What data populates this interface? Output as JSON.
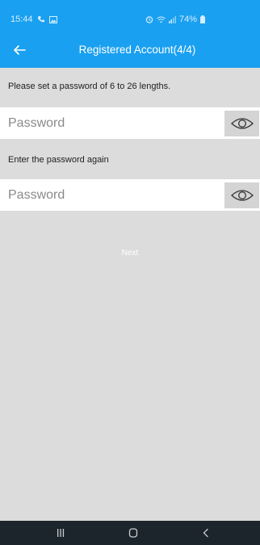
{
  "status_bar": {
    "time": "15:44",
    "battery": "74%"
  },
  "app_bar": {
    "title": "Registered Account(4/4)"
  },
  "form": {
    "password_hint": "Please set a password of 6 to 26 lengths.",
    "password_placeholder": "Password",
    "confirm_hint": "Enter the password again",
    "confirm_placeholder": "Password",
    "next_label": "Next"
  },
  "colors": {
    "primary": "#1aa0f0",
    "background": "#dcdcdc",
    "nav_bar": "#1c252c"
  },
  "icons": {
    "back": "arrow-left-icon",
    "toggle_visibility": "eye-icon"
  }
}
